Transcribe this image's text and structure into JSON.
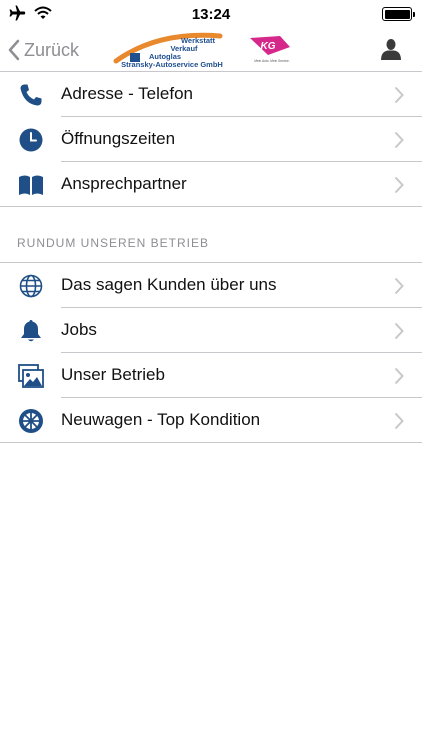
{
  "status_bar": {
    "time": "13:24",
    "icons": [
      "airplane-icon",
      "wifi-icon",
      "battery-icon"
    ]
  },
  "nav": {
    "back_label": "Zurück",
    "logo": {
      "line1": "Werkstatt",
      "line2": "Verkauf",
      "line3": "Autoglas",
      "company": "Stransky-Autoservice GmbH",
      "badge": "KG",
      "badge_sub": "Mein Auto. Mein Service."
    },
    "user_icon": "person-icon"
  },
  "list_one": [
    {
      "label": "Adresse - Telefon",
      "icon": "phone-icon"
    },
    {
      "label": "Öffnungszeiten",
      "icon": "clock-icon"
    },
    {
      "label": "Ansprechpartner",
      "icon": "book-icon"
    }
  ],
  "section_header": "RUNDUM UNSEREN BETRIEB",
  "list_two": [
    {
      "label": "Das sagen Kunden über uns",
      "icon": "globe-icon"
    },
    {
      "label": "Jobs",
      "icon": "bell-icon"
    },
    {
      "label": "Unser Betrieb",
      "icon": "photos-icon"
    },
    {
      "label": "Neuwagen - Top Kondition",
      "icon": "wheel-icon"
    }
  ],
  "colors": {
    "icon_blue": "#1f4f86",
    "logo_orange": "#e8892e",
    "logo_blue": "#1e4f8f",
    "logo_pink": "#d6278a",
    "chevron_gray": "#c7c7cc",
    "back_gray": "#8e8e93"
  }
}
